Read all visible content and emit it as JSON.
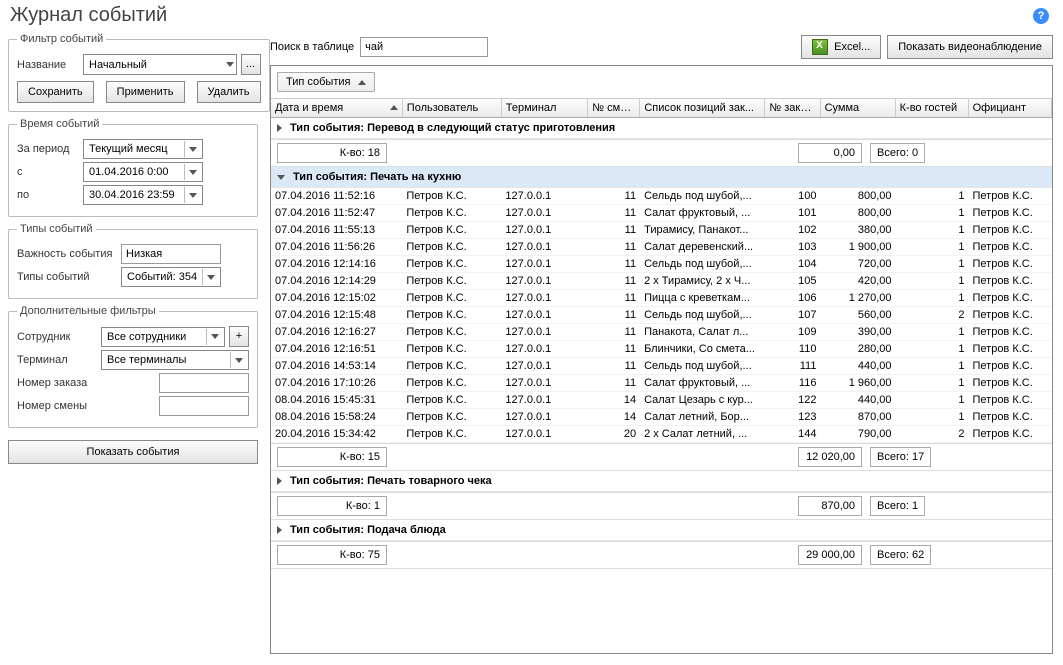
{
  "title": "Журнал событий",
  "helpSymbol": "?",
  "filter": {
    "legend": "Фильтр событий",
    "nameLabel": "Название",
    "nameValue": "Начальный",
    "ellipsis": "...",
    "saveBtn": "Сохранить",
    "applyBtn": "Применить",
    "deleteBtn": "Удалить"
  },
  "time": {
    "legend": "Время событий",
    "periodLabel": "За период",
    "periodValue": "Текущий месяц",
    "fromLabel": "с",
    "fromValue": "01.04.2016 0:00",
    "toLabel": "по",
    "toValue": "30.04.2016 23:59"
  },
  "types": {
    "legend": "Типы событий",
    "importanceLabel": "Важность события",
    "importanceValue": "Низкая",
    "typesLabel": "Типы событий",
    "typesValue": "Событий: 354"
  },
  "extra": {
    "legend": "Дополнительные фильтры",
    "employeeLabel": "Сотрудник",
    "employeeValue": "Все сотрудники",
    "plus": "+",
    "terminalLabel": "Терминал",
    "terminalValue": "Все терминалы",
    "orderNumLabel": "Номер заказа",
    "orderNumValue": "",
    "shiftNumLabel": "Номер смены",
    "shiftNumValue": ""
  },
  "showBtn": "Показать события",
  "searchLabel": "Поиск в таблице",
  "searchValue": "чай",
  "excelBtn": "Excel...",
  "videoBtn": "Показать видеонаблюдение",
  "groupBy": "Тип события",
  "columns": {
    "dt": "Дата и время",
    "user": "Пользователь",
    "term": "Терминал",
    "shift": "№ смены",
    "pos": "Список позиций зак...",
    "ord": "№ заказа",
    "sum": "Сумма",
    "guests": "К-во гостей",
    "waiter": "Официант"
  },
  "groups": {
    "g1": {
      "title": "Тип события: Перевод в следующий статус приготовления",
      "countLabel": "К-во: 18",
      "sum": "0,00",
      "totalLabel": "Всего: 0"
    },
    "g2": {
      "title": "Тип события: Печать на кухню",
      "countLabel": "К-во: 15",
      "sum": "12 020,00",
      "totalLabel": "Всего: 17"
    },
    "g3": {
      "title": "Тип события: Печать товарного чека",
      "countLabel": "К-во: 1",
      "sum": "870,00",
      "totalLabel": "Всего: 1"
    },
    "g4": {
      "title": "Тип события: Подача блюда",
      "countLabel": "К-во: 75",
      "sum": "29 000,00",
      "totalLabel": "Всего: 62"
    }
  },
  "rows": [
    {
      "dt": "07.04.2016 11:52:16",
      "user": "Петров К.С.",
      "term": "127.0.0.1",
      "shift": "11",
      "pos": "Сельдь под шубой,...",
      "ord": "100",
      "sum": "800,00",
      "g": "1",
      "w": "Петров К.С."
    },
    {
      "dt": "07.04.2016 11:52:47",
      "user": "Петров К.С.",
      "term": "127.0.0.1",
      "shift": "11",
      "pos": "Салат фруктовый, ...",
      "ord": "101",
      "sum": "800,00",
      "g": "1",
      "w": "Петров К.С."
    },
    {
      "dt": "07.04.2016 11:55:13",
      "user": "Петров К.С.",
      "term": "127.0.0.1",
      "shift": "11",
      "pos": "Тирамису, Панакот...",
      "ord": "102",
      "sum": "380,00",
      "g": "1",
      "w": "Петров К.С."
    },
    {
      "dt": "07.04.2016 11:56:26",
      "user": "Петров К.С.",
      "term": "127.0.0.1",
      "shift": "11",
      "pos": "Салат деревенский...",
      "ord": "103",
      "sum": "1 900,00",
      "g": "1",
      "w": "Петров К.С."
    },
    {
      "dt": "07.04.2016 12:14:16",
      "user": "Петров К.С.",
      "term": "127.0.0.1",
      "shift": "11",
      "pos": "Сельдь под шубой,...",
      "ord": "104",
      "sum": "720,00",
      "g": "1",
      "w": "Петров К.С."
    },
    {
      "dt": "07.04.2016 12:14:29",
      "user": "Петров К.С.",
      "term": "127.0.0.1",
      "shift": "11",
      "pos": "2 x Тирамису, 2 x Ч...",
      "ord": "105",
      "sum": "420,00",
      "g": "1",
      "w": "Петров К.С."
    },
    {
      "dt": "07.04.2016 12:15:02",
      "user": "Петров К.С.",
      "term": "127.0.0.1",
      "shift": "11",
      "pos": "Пицца с креветкам...",
      "ord": "106",
      "sum": "1 270,00",
      "g": "1",
      "w": "Петров К.С."
    },
    {
      "dt": "07.04.2016 12:15:48",
      "user": "Петров К.С.",
      "term": "127.0.0.1",
      "shift": "11",
      "pos": "Сельдь под шубой,...",
      "ord": "107",
      "sum": "560,00",
      "g": "2",
      "w": "Петров К.С."
    },
    {
      "dt": "07.04.2016 12:16:27",
      "user": "Петров К.С.",
      "term": "127.0.0.1",
      "shift": "11",
      "pos": "Панакота, Салат л...",
      "ord": "109",
      "sum": "390,00",
      "g": "1",
      "w": "Петров К.С."
    },
    {
      "dt": "07.04.2016 12:16:51",
      "user": "Петров К.С.",
      "term": "127.0.0.1",
      "shift": "11",
      "pos": "Блинчики, Со смета...",
      "ord": "110",
      "sum": "280,00",
      "g": "1",
      "w": "Петров К.С."
    },
    {
      "dt": "07.04.2016 14:53:14",
      "user": "Петров К.С.",
      "term": "127.0.0.1",
      "shift": "11",
      "pos": "Сельдь под шубой,...",
      "ord": "111",
      "sum": "440,00",
      "g": "1",
      "w": "Петров К.С."
    },
    {
      "dt": "07.04.2016 17:10:26",
      "user": "Петров К.С.",
      "term": "127.0.0.1",
      "shift": "11",
      "pos": "Салат фруктовый, ...",
      "ord": "116",
      "sum": "1 960,00",
      "g": "1",
      "w": "Петров К.С."
    },
    {
      "dt": "08.04.2016 15:45:31",
      "user": "Петров К.С.",
      "term": "127.0.0.1",
      "shift": "14",
      "pos": "Салат Цезарь с кур...",
      "ord": "122",
      "sum": "440,00",
      "g": "1",
      "w": "Петров К.С."
    },
    {
      "dt": "08.04.2016 15:58:24",
      "user": "Петров К.С.",
      "term": "127.0.0.1",
      "shift": "14",
      "pos": "Салат летний, Бор...",
      "ord": "123",
      "sum": "870,00",
      "g": "1",
      "w": "Петров К.С."
    },
    {
      "dt": "20.04.2016 15:34:42",
      "user": "Петров К.С.",
      "term": "127.0.0.1",
      "shift": "20",
      "pos": "2 x Салат летний, ...",
      "ord": "144",
      "sum": "790,00",
      "g": "2",
      "w": "Петров К.С."
    }
  ]
}
